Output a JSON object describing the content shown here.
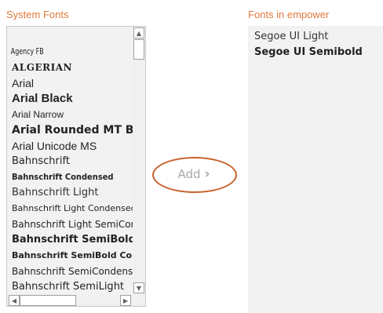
{
  "system_fonts": {
    "heading": "System Fonts",
    "items": [
      {
        "label": "Agency FB"
      },
      {
        "label": "ALGERIAN"
      },
      {
        "label": "Arial"
      },
      {
        "label": "Arial Black"
      },
      {
        "label": "Arial Narrow"
      },
      {
        "label": "Arial Rounded MT Bold"
      },
      {
        "label": "Arial Unicode MS"
      },
      {
        "label": "Bahnschrift"
      },
      {
        "label": "Bahnschrift Condensed"
      },
      {
        "label": "Bahnschrift Light"
      },
      {
        "label": "Bahnschrift Light Condensed"
      },
      {
        "label": "Bahnschrift Light SemiCondensed"
      },
      {
        "label": "Bahnschrift SemiBold"
      },
      {
        "label": "Bahnschrift SemiBold Condensed"
      },
      {
        "label": "Bahnschrift SemiCondensed"
      },
      {
        "label": "Bahnschrift SemiLight"
      }
    ]
  },
  "add_button": {
    "label": "Add",
    "chevron": "›"
  },
  "empower_fonts": {
    "heading": "Fonts in empower",
    "items": [
      {
        "label": "Segoe UI Light"
      },
      {
        "label": "Segoe UI Semibold"
      }
    ]
  },
  "colors": {
    "heading": "#e07a3c",
    "highlight_ring": "#c8602a",
    "disabled_text": "#a8a8a8",
    "list_bg": "#f2f2f2"
  },
  "icons": {
    "scroll_up": "triangle-up",
    "scroll_down": "triangle-down",
    "scroll_left": "triangle-left",
    "scroll_right": "triangle-right",
    "add_chevron": "chevron-right"
  }
}
